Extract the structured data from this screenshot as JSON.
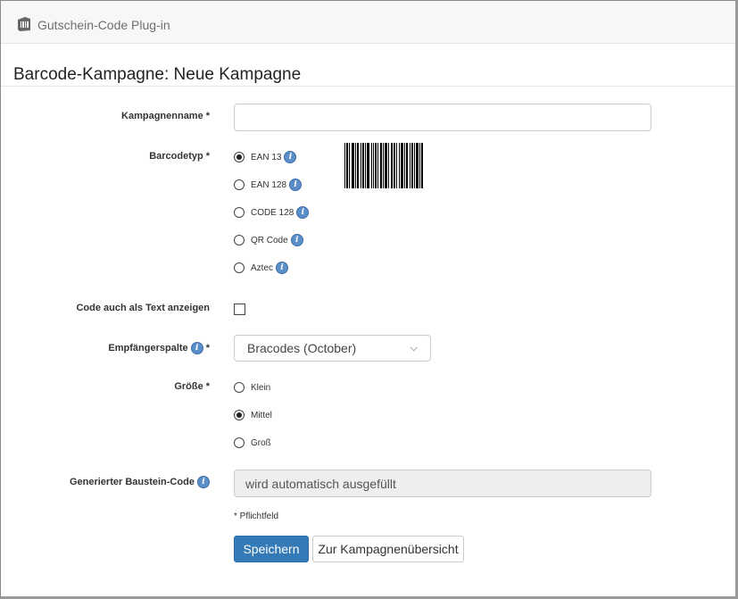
{
  "app": {
    "title": "Gutschein-Code Plug-in",
    "icon": "barcode-tag-icon"
  },
  "page": {
    "title": "Barcode-Kampagne: Neue Kampagne"
  },
  "form": {
    "campaign_name": {
      "label": "Kampagnenname",
      "required": "*",
      "value": ""
    },
    "barcode_type": {
      "label": "Barcodetyp",
      "required": "*",
      "options": [
        {
          "label": "EAN 13",
          "checked": true,
          "info": "i"
        },
        {
          "label": "EAN 128",
          "checked": false,
          "info": "i"
        },
        {
          "label": "CODE 128",
          "checked": false,
          "info": "i"
        },
        {
          "label": "QR Code",
          "checked": false,
          "info": "i"
        },
        {
          "label": "Aztec",
          "checked": false,
          "info": "i"
        }
      ]
    },
    "show_text": {
      "label": "Code auch als Text anzeigen",
      "checked": false
    },
    "recipient_column": {
      "label": "Empfängerspalte",
      "info": "i",
      "required": "*",
      "value": "Bracodes (October)",
      "chevron": "⌵"
    },
    "size": {
      "label": "Größe",
      "required": "*",
      "options": [
        {
          "label": "Klein",
          "checked": false
        },
        {
          "label": "Mittel",
          "checked": true
        },
        {
          "label": "Groß",
          "checked": false
        }
      ]
    },
    "generated_code": {
      "label": "Generierter Baustein-Code",
      "info": "i",
      "value": "wird automatisch ausgefüllt"
    },
    "required_hint": "* Pflichtfeld",
    "save_label": "Speichern",
    "overview_label": "Zur Kampagnenübersicht"
  },
  "colors": {
    "primary": "#337ab7",
    "info": "#5b8fc9"
  }
}
